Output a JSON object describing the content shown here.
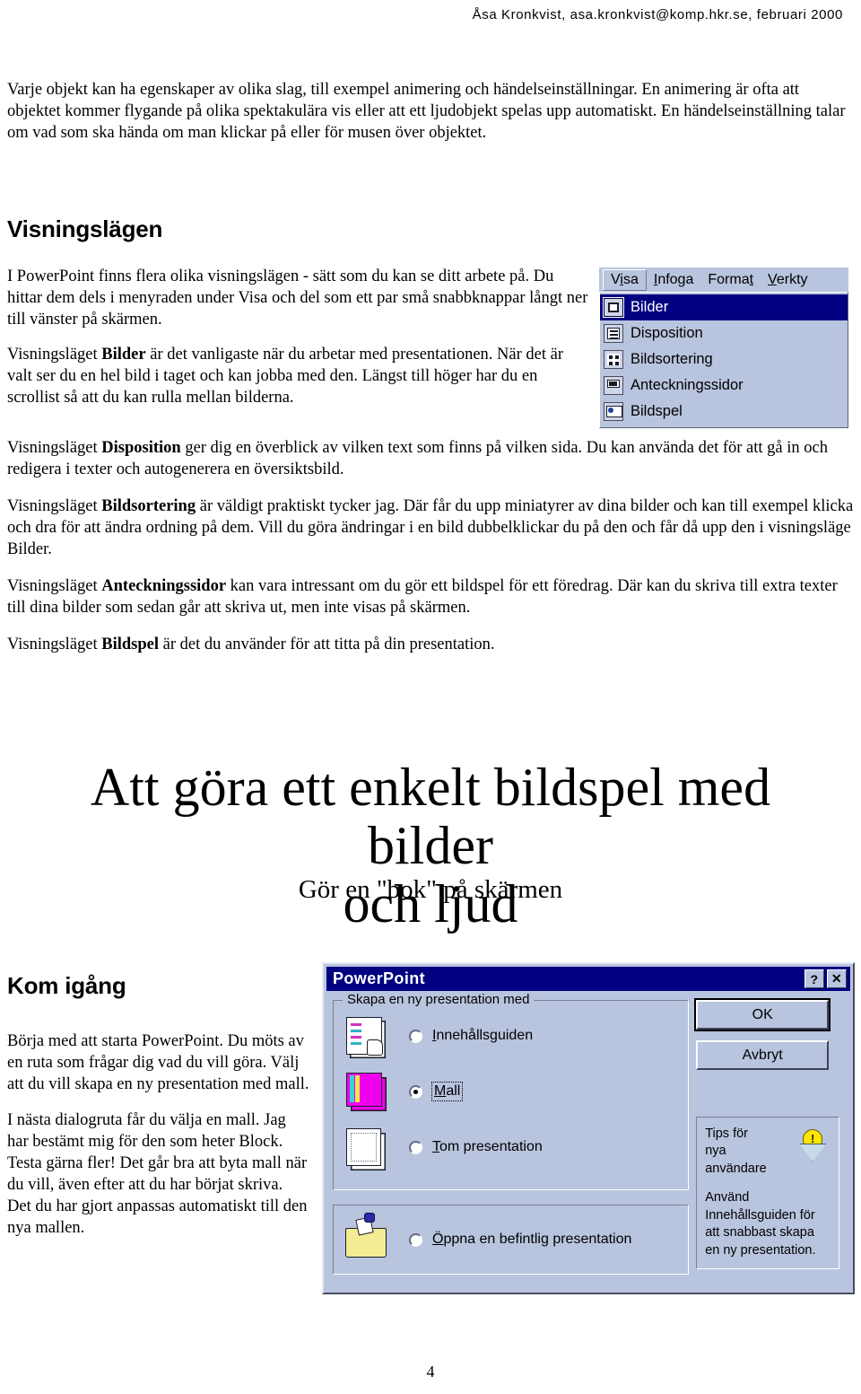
{
  "header": {
    "byline": "Åsa Kronkvist, asa.kronkvist@komp.hkr.se, februari 2000"
  },
  "intro": {
    "paragraph": "Varje objekt kan ha egenskaper av olika slag, till exempel animering och händelseinställningar. En animering är ofta att objektet kommer flygande på olika spektakulära vis eller att ett ljudobjekt spelas upp automatiskt. En händelseinställning talar om vad som ska hända om man klickar på eller för musen över objektet."
  },
  "visningslagen": {
    "heading": "Visningslägen",
    "p1": "I PowerPoint finns flera olika visningslägen - sätt som du kan se ditt arbete på. Du hittar dem dels i menyraden under Visa och del som ett par små snabbknappar långt ner till vänster på skärmen.",
    "p2_pre": "Visningsläget ",
    "p2_bold": "Bilder",
    "p2_post": " är det vanligaste när du arbetar med presentationen. När det är valt ser du en hel bild i taget och kan jobba med den. Längst till höger har du en scrollist så att du kan rulla mellan bilderna.",
    "p3_pre": "Visningsläget ",
    "p3_bold": "Disposition",
    "p3_post": " ger dig en överblick av vilken text som finns på vilken sida. Du kan använda det för att gå in och redigera i texter och autogenerera en översiktsbild.",
    "p4_pre": "Visningsläget ",
    "p4_bold": "Bildsortering",
    "p4_post": " är väldigt praktiskt tycker jag. Där får du upp miniatyrer av dina bilder och kan till exempel klicka och dra för att ändra ordning på dem. Vill du göra ändringar i en bild dubbelklickar du på den och får då upp den i visningsläge Bilder.",
    "p5_pre": "Visningsläget ",
    "p5_bold": "Anteckningssidor",
    "p5_post": " kan vara intressant om du gör ett bildspel för ett föredrag. Där kan du skriva till extra texter till dina bilder som sedan går att skriva ut, men inte visas på skärmen.",
    "p6_pre": "Visningsläget ",
    "p6_bold": "Bildspel",
    "p6_post": " är det du använder för att titta på din presentation."
  },
  "menu_screenshot": {
    "menubar": [
      {
        "label_pre": "V",
        "label_accel": "i",
        "label_post": "sa",
        "active": true
      },
      {
        "label_pre": "",
        "label_accel": "I",
        "label_post": "nfoga",
        "active": false
      },
      {
        "label_pre": "Forma",
        "label_accel": "t",
        "label_post": "",
        "active": false
      },
      {
        "label_pre": "",
        "label_accel": "V",
        "label_post": "erkty",
        "active": false
      }
    ],
    "items": [
      {
        "label": "Bilder",
        "icon": "slide-view-icon",
        "selected": true
      },
      {
        "label": "Disposition",
        "icon": "outline-view-icon",
        "selected": false
      },
      {
        "label": "Bildsortering",
        "icon": "slide-sorter-icon",
        "selected": false
      },
      {
        "label": "Anteckningssidor",
        "icon": "notes-page-icon",
        "selected": false
      },
      {
        "label": "Bildspel",
        "icon": "slide-show-icon",
        "selected": false
      }
    ],
    "colors": {
      "highlight": "#000080",
      "face": "#b9c4de"
    }
  },
  "doc_title": {
    "line1": "Att göra ett enkelt bildspel med bilder",
    "line2": "och ljud",
    "subtitle": "Gör en \"bok\" på skärmen"
  },
  "komigang": {
    "heading": "Kom igång",
    "p1": "Börja med att starta PowerPoint. Du möts av en ruta som frågar dig vad du vill göra. Välj att du vill skapa en ny presentation med mall.",
    "p2": "I nästa dialogruta får du välja en mall. Jag har bestämt mig för den som heter Block. Testa gärna fler! Det går bra att byta mall när du vill, även efter att du har börjat skriva. Det du har gjort anpassas automatiskt till den nya mallen."
  },
  "pp_dialog": {
    "title": "PowerPoint",
    "help_button": "?",
    "close_button": "✕",
    "group_title": "Skapa en ny presentation med",
    "options": [
      {
        "label_accel": "I",
        "label_rest": "nnehållsguiden",
        "checked": false,
        "focused": false,
        "icon": "autocontent-wizard-icon"
      },
      {
        "label_accel": "M",
        "label_rest": "all",
        "checked": true,
        "focused": true,
        "icon": "template-icon"
      },
      {
        "label_accel": "T",
        "label_rest": "om presentation",
        "checked": false,
        "focused": false,
        "icon": "blank-presentation-icon"
      }
    ],
    "open_option": {
      "label_accel": "Ö",
      "label_rest": "ppna en befintlig presentation",
      "checked": false,
      "icon": "open-folder-icon"
    },
    "ok_label": "OK",
    "cancel_label": "Avbryt",
    "tips_title": "Tips för\nnya\nanvändare",
    "tips_body": "Använd Innehållsguiden för att snabbast skapa en ny presentation.",
    "colors": {
      "titlebar": "#000080",
      "face": "#b9c4de",
      "template_icon": "#ee00ee"
    }
  },
  "footer": {
    "page_number": "4"
  }
}
